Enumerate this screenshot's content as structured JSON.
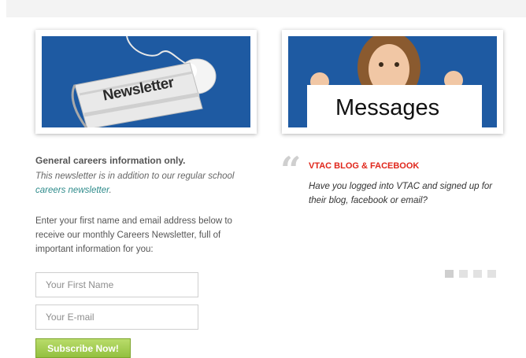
{
  "newsletter_card": {
    "image_alt": "Newsletter",
    "image_text": "Newsletter"
  },
  "messages_card": {
    "image_alt": "Messages",
    "image_text": "Messages"
  },
  "signup": {
    "lead": "General careers information only.",
    "note_prefix": "This newsletter is in addition to our regular school ",
    "note_link": "careers newsletter",
    "note_suffix": ".",
    "paragraph": "Enter your first name and email address below to receive our monthly Careers Newsletter, full of important information for you:",
    "first_name_placeholder": "Your First Name",
    "email_placeholder": "Your E-mail",
    "subscribe_label": "Subscribe Now!"
  },
  "blog": {
    "quote_mark": "“",
    "title": "VTAC BLOG & FACEBOOK",
    "body": "Have you logged into VTAC and signed up for their blog, facebook or email?"
  },
  "carousel": {
    "slide_count": 4,
    "active_index": 0
  },
  "colors": {
    "panel_blue": "#1e5aa2",
    "blog_title_red": "#e0261b",
    "button_green": "#93c03f",
    "link_teal": "#2e8b8b"
  }
}
